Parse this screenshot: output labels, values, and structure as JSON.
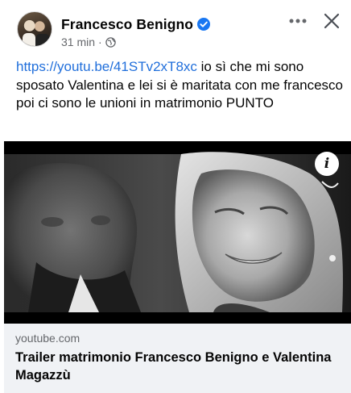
{
  "post": {
    "author": "Francesco Benigno",
    "verified_icon": "verified-badge-icon",
    "time": "31 min",
    "separator": "·",
    "audience_icon": "globe-icon",
    "more_icon": "more-options-icon",
    "close_icon": "close-icon",
    "link_text": "https://youtu.be/41STv2xT8xc",
    "body_text": " io sì che mi sono sposato Valentina e lei si è maritata con me francesco  poi ci sono le unioni in matrimonio PUNTO",
    "media": {
      "type": "video-thumbnail",
      "info_label": "i",
      "info_icon": "info-icon"
    },
    "link_card": {
      "domain": "youtube.com",
      "title": "Trailer matrimonio Francesco Benigno e Valentina Magazzù"
    }
  },
  "colors": {
    "link": "#216fdb",
    "verified": "#1877f2",
    "secondary_text": "#65676b",
    "card_background": "#f0f2f5"
  }
}
